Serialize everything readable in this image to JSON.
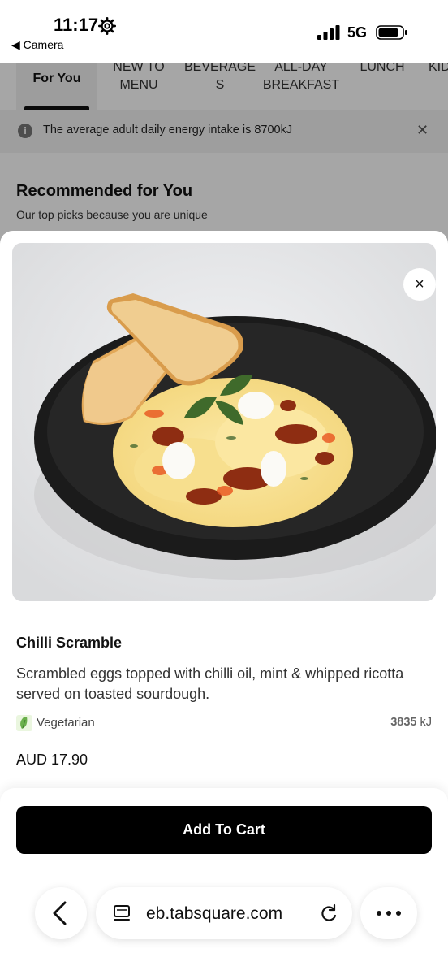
{
  "status_bar": {
    "time": "11:17",
    "back_app": "◀ Camera",
    "network": "5G",
    "icons": [
      "gear-icon",
      "signal-icon",
      "battery-icon"
    ]
  },
  "background_page": {
    "categories": [
      {
        "label": "For You",
        "active": true
      },
      {
        "label": "NEW TO\nMENU",
        "active": false
      },
      {
        "label": "BEVERAGE\nS",
        "active": false
      },
      {
        "label": "ALL-DAY\nBREAKFAST",
        "active": false
      },
      {
        "label": "LUNCH",
        "active": false
      },
      {
        "label": "KID",
        "active": false
      }
    ],
    "info_banner": "The average adult daily energy intake is 8700kJ",
    "section_title": "Recommended for You",
    "section_subtitle": "Our top picks because you are unique"
  },
  "item": {
    "name": "Chilli Scramble",
    "description": "Scrambled eggs topped with chilli oil, mint & whipped ricotta served on toasted sourdough.",
    "dietary_label": "Vegetarian",
    "energy_value": "3835",
    "energy_unit": "kJ",
    "price": "AUD 17.90",
    "add_button": "Add To Cart",
    "close_symbol": "×"
  },
  "browser": {
    "url": "eb.tabsquare.com",
    "icons": [
      "back-arrow-icon",
      "tabs-icon",
      "reload-icon",
      "more-icon"
    ]
  },
  "colors": {
    "primary_button": "#000000",
    "background": "#ffffff",
    "dim_overlay": "rgba(0,0,0,0.35)"
  }
}
